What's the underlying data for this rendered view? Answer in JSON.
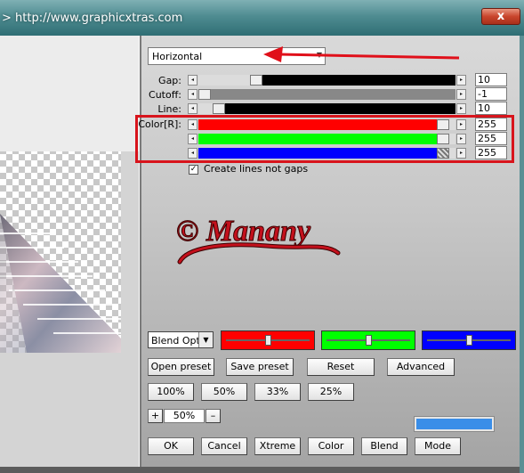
{
  "window": {
    "title": "> http://www.graphicxtras.com",
    "close_label": "x"
  },
  "direction": {
    "value": "Horizontal"
  },
  "sliders": [
    {
      "label": "Gap:",
      "value": "10",
      "level": 0.22
    },
    {
      "label": "Cutoff:",
      "value": "-1",
      "level": 0.0
    },
    {
      "label": "Line:",
      "value": "10",
      "level": 0.06
    }
  ],
  "color_sliders": [
    {
      "label": "Color[R]:",
      "value": "255",
      "color": "#ff0000",
      "level": 1.0
    },
    {
      "label": "",
      "value": "255",
      "color": "#00ff00",
      "level": 1.0
    },
    {
      "label": "",
      "value": "255",
      "color": "#0000ff",
      "level": 1.0
    }
  ],
  "option": {
    "checked": true,
    "label": "Create lines not gaps"
  },
  "logo": {
    "text": "© Manany"
  },
  "blend": {
    "value": "Blend Optio"
  },
  "mini_sliders": [
    {
      "name": "red",
      "color": "#ff0000",
      "level": 0.5
    },
    {
      "name": "green",
      "color": "#00ff00",
      "level": 0.5
    },
    {
      "name": "blue",
      "color": "#0000ff",
      "level": 0.5
    }
  ],
  "preset_buttons": {
    "open": "Open preset",
    "save": "Save preset",
    "reset": "Reset",
    "advanced": "Advanced"
  },
  "zoom_buttons": [
    "100%",
    "50%",
    "33%",
    "25%"
  ],
  "zoom": {
    "plus": "+",
    "value": "50%",
    "minus": "–"
  },
  "swatch_color": "#3a8ee8",
  "bottom_buttons": {
    "ok": "OK",
    "cancel": "Cancel",
    "xtreme": "Xtreme",
    "color": "Color",
    "blend": "Blend",
    "mode": "Mode"
  }
}
